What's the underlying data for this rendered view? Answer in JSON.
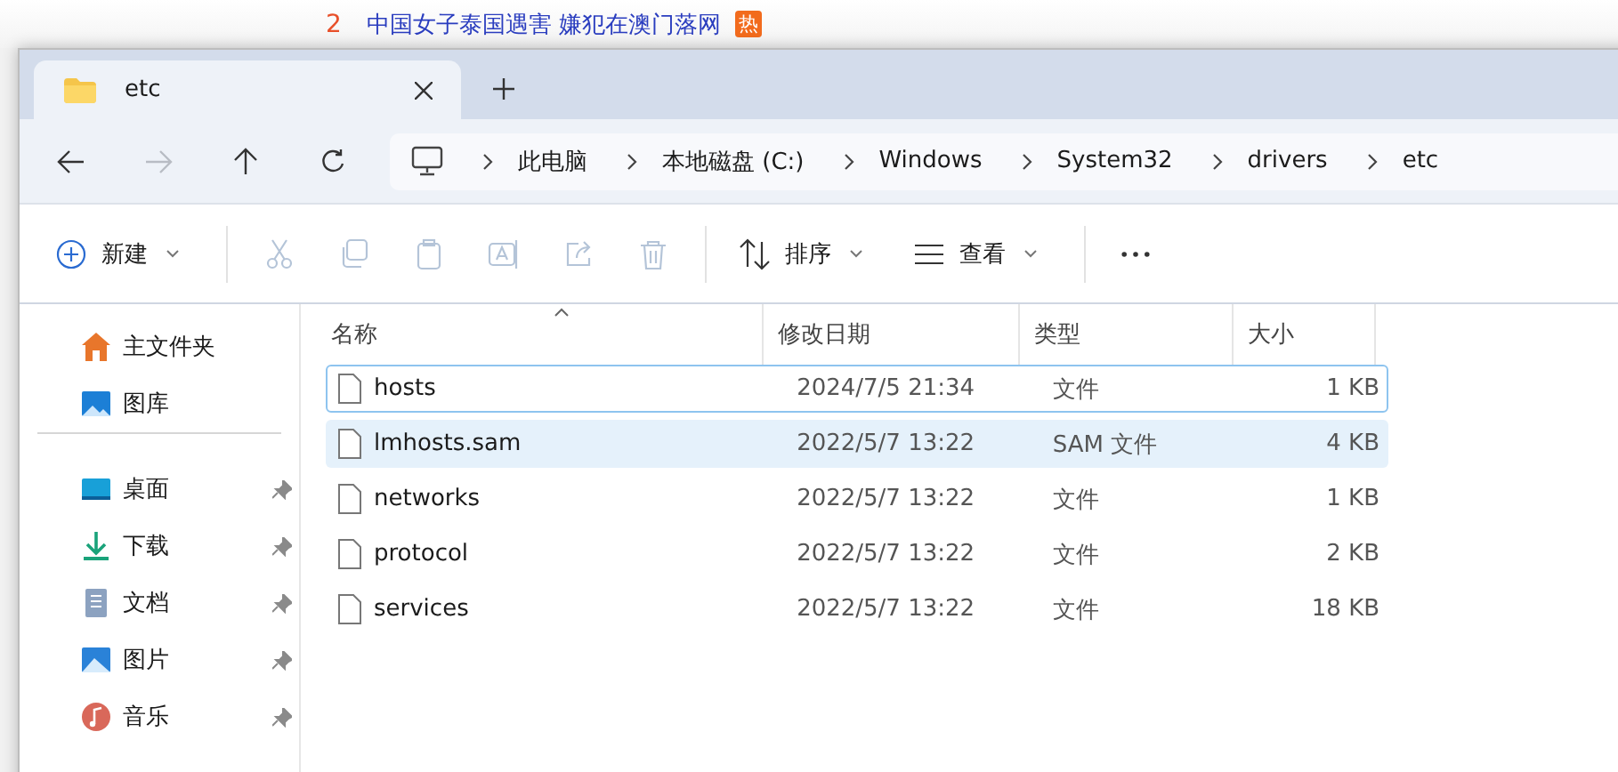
{
  "background_page": {
    "rank": "2",
    "headline": "中国女子泰国遇害 嫌犯在澳门落网",
    "badge": "热"
  },
  "tabs": [
    {
      "title": "etc",
      "selected": true
    }
  ],
  "nav": [
    {
      "kind": "back",
      "disabled": false
    },
    {
      "kind": "forward",
      "disabled": true
    },
    {
      "kind": "up",
      "disabled": false
    },
    {
      "kind": "refresh",
      "disabled": false
    }
  ],
  "breadcrumb": [
    "此电脑",
    "本地磁盘 (C:)",
    "Windows",
    "System32",
    "drivers",
    "etc"
  ],
  "toolbar": [
    {
      "kind": "new",
      "label": "新建",
      "disabled": false
    },
    {
      "kind": "cut",
      "disabled": true
    },
    {
      "kind": "copy",
      "disabled": true
    },
    {
      "kind": "paste",
      "disabled": true
    },
    {
      "kind": "rename",
      "disabled": true
    },
    {
      "kind": "share",
      "disabled": true
    },
    {
      "kind": "delete",
      "disabled": true
    },
    {
      "kind": "sort",
      "label": "排序",
      "disabled": false
    },
    {
      "kind": "view",
      "label": "查看",
      "disabled": false
    },
    {
      "kind": "more",
      "disabled": false
    }
  ],
  "sidebar": {
    "items": [
      {
        "kind": "home",
        "label": "主文件夹",
        "pinned": false
      },
      {
        "kind": "gallery",
        "label": "图库",
        "pinned": false
      },
      {
        "kind": "desktop",
        "label": "桌面",
        "pinned": true
      },
      {
        "kind": "download",
        "label": "下载",
        "pinned": true
      },
      {
        "kind": "documents",
        "label": "文档",
        "pinned": true
      },
      {
        "kind": "pictures",
        "label": "图片",
        "pinned": true
      },
      {
        "kind": "music",
        "label": "音乐",
        "pinned": true
      }
    ]
  },
  "table": {
    "columns": [
      "名称",
      "修改日期",
      "类型",
      "大小"
    ],
    "rows": [
      {
        "name": "hosts",
        "modified": "2024/7/5 21:34",
        "type": "文件",
        "size": "1 KB",
        "focused": true,
        "selected": false
      },
      {
        "name": "lmhosts.sam",
        "modified": "2022/5/7 13:22",
        "type": "SAM 文件",
        "size": "4 KB",
        "focused": false,
        "selected": true
      },
      {
        "name": "networks",
        "modified": "2022/5/7 13:22",
        "type": "文件",
        "size": "1 KB",
        "focused": false,
        "selected": false
      },
      {
        "name": "protocol",
        "modified": "2022/5/7 13:22",
        "type": "文件",
        "size": "2 KB",
        "focused": false,
        "selected": false
      },
      {
        "name": "services",
        "modified": "2022/5/7 13:22",
        "type": "文件",
        "size": "18 KB",
        "focused": false,
        "selected": false
      }
    ]
  }
}
